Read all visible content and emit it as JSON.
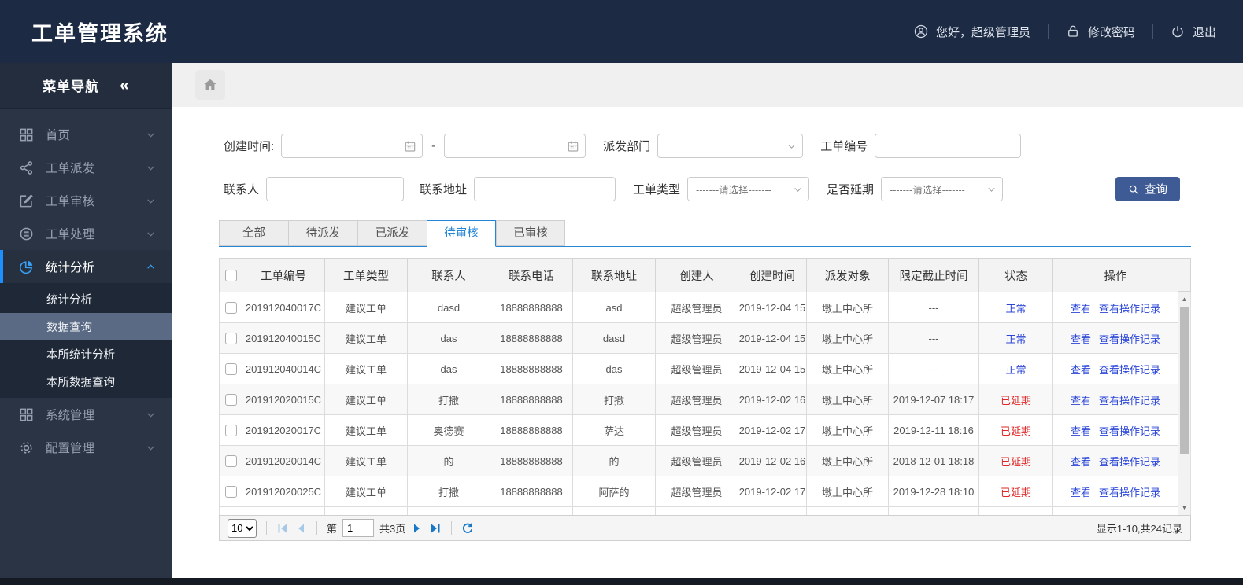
{
  "app": {
    "title": "工单管理系统"
  },
  "topbar": {
    "greeting": "您好，超级管理员",
    "change_password": "修改密码",
    "logout": "退出"
  },
  "sidebar": {
    "title": "菜单导航",
    "collapse_icon": "«",
    "items": [
      {
        "label": "首页",
        "icon": "grid-icon",
        "expanded": false,
        "active": false
      },
      {
        "label": "工单派发",
        "icon": "share-icon",
        "expanded": false,
        "active": false
      },
      {
        "label": "工单审核",
        "icon": "edit-icon",
        "expanded": false,
        "active": false
      },
      {
        "label": "工单处理",
        "icon": "process-icon",
        "expanded": false,
        "active": false
      },
      {
        "label": "统计分析",
        "icon": "pie-chart-icon",
        "expanded": true,
        "active": true,
        "children": [
          {
            "label": "统计分析",
            "selected": false
          },
          {
            "label": "数据查询",
            "selected": true
          },
          {
            "label": "本所统计分析",
            "selected": false
          },
          {
            "label": "本所数据查询",
            "selected": false
          }
        ]
      },
      {
        "label": "系统管理",
        "icon": "grid2-icon",
        "expanded": false,
        "active": false
      },
      {
        "label": "配置管理",
        "icon": "gear-icon",
        "expanded": false,
        "active": false
      }
    ]
  },
  "filters": {
    "create_time_label": "创建时间:",
    "create_time_start": "",
    "create_time_end": "",
    "range_separator": "-",
    "dispatch_dept_label": "派发部门",
    "dispatch_dept_value": "",
    "order_no_label": "工单编号",
    "order_no_value": "",
    "contact_label": "联系人",
    "contact_value": "",
    "address_label": "联系地址",
    "address_value": "",
    "order_type_label": "工单类型",
    "order_type_value": "-------请选择-------",
    "delay_label": "是否延期",
    "delay_value": "-------请选择-------",
    "search_button": "查询"
  },
  "tabs": [
    {
      "label": "全部",
      "active": false
    },
    {
      "label": "待派发",
      "active": false
    },
    {
      "label": "已派发",
      "active": false
    },
    {
      "label": "待审核",
      "active": true
    },
    {
      "label": "已审核",
      "active": false
    }
  ],
  "table": {
    "columns": [
      "工单编号",
      "工单类型",
      "联系人",
      "联系电话",
      "联系地址",
      "创建人",
      "创建时间",
      "派发对象",
      "限定截止时间",
      "状态",
      "操作"
    ],
    "actions": [
      "查看",
      "查看操作记录"
    ],
    "rows": [
      {
        "order_no": "201912040017C",
        "type": "建议工单",
        "contact": "dasd",
        "phone": "18888888888",
        "address": "asd",
        "creator": "超级管理员",
        "created": "2019-12-04 15",
        "target": "墩上中心所",
        "deadline": "---",
        "status": "正常",
        "status_type": "normal"
      },
      {
        "order_no": "201912040015C",
        "type": "建议工单",
        "contact": "das",
        "phone": "18888888888",
        "address": "dasd",
        "creator": "超级管理员",
        "created": "2019-12-04 15",
        "target": "墩上中心所",
        "deadline": "---",
        "status": "正常",
        "status_type": "normal"
      },
      {
        "order_no": "201912040014C",
        "type": "建议工单",
        "contact": "das",
        "phone": "18888888888",
        "address": "das",
        "creator": "超级管理员",
        "created": "2019-12-04 15",
        "target": "墩上中心所",
        "deadline": "---",
        "status": "正常",
        "status_type": "normal"
      },
      {
        "order_no": "201912020015C",
        "type": "建议工单",
        "contact": "打撒",
        "phone": "18888888888",
        "address": "打撒",
        "creator": "超级管理员",
        "created": "2019-12-02 16",
        "target": "墩上中心所",
        "deadline": "2019-12-07 18:17",
        "status": "已延期",
        "status_type": "overdue"
      },
      {
        "order_no": "201912020017C",
        "type": "建议工单",
        "contact": "奥德赛",
        "phone": "18888888888",
        "address": "萨达",
        "creator": "超级管理员",
        "created": "2019-12-02 17",
        "target": "墩上中心所",
        "deadline": "2019-12-11 18:16",
        "status": "已延期",
        "status_type": "overdue"
      },
      {
        "order_no": "201912020014C",
        "type": "建议工单",
        "contact": "的",
        "phone": "18888888888",
        "address": "的",
        "creator": "超级管理员",
        "created": "2019-12-02 16",
        "target": "墩上中心所",
        "deadline": "2018-12-01 18:18",
        "status": "已延期",
        "status_type": "overdue"
      },
      {
        "order_no": "201912020025C",
        "type": "建议工单",
        "contact": "打撒",
        "phone": "18888888888",
        "address": "阿萨的",
        "creator": "超级管理员",
        "created": "2019-12-02 17",
        "target": "墩上中心所",
        "deadline": "2019-12-28 18:10",
        "status": "已延期",
        "status_type": "overdue"
      }
    ]
  },
  "pagination": {
    "page_size": "10",
    "page_prefix": "第",
    "current_page": "1",
    "total_pages": "共3页",
    "summary": "显示1-10,共24记录"
  },
  "colors": {
    "topbar_bg": "#1c2a43",
    "sidebar_bg": "#2b3445",
    "accent": "#2486d9",
    "link": "#2b46d8",
    "status_normal": "#2b46d8",
    "status_overdue": "#e02626",
    "search_button_bg": "#3e5b96"
  }
}
